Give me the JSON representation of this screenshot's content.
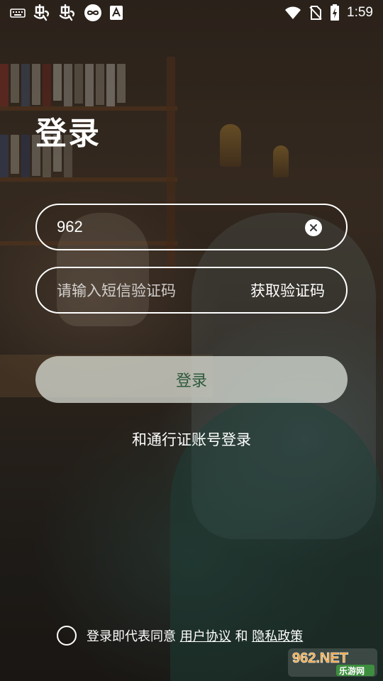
{
  "status_bar": {
    "left_icons": [
      "keyboard-icon",
      "notification-app-icon",
      "notification-app-icon",
      "infinity-app-icon",
      "text-app-icon"
    ],
    "right_icons": [
      "wifi-icon",
      "no-sim-icon",
      "battery-charging-icon"
    ],
    "time": "1:59"
  },
  "page": {
    "title": "登录"
  },
  "phone_field": {
    "value": "962"
  },
  "code_field": {
    "placeholder": "请输入短信验证码",
    "get_code_label": "获取验证码"
  },
  "login_button": {
    "label": "登录"
  },
  "alt_login": {
    "label": "和通行证账号登录"
  },
  "agreement": {
    "prefix": "登录即代表同意",
    "user_agreement": "用户协议",
    "conjunction": "和",
    "privacy_policy": "隐私政策"
  },
  "watermark": {
    "text_top": "962.NET",
    "text_bottom": "乐游网"
  },
  "colors": {
    "login_text": "#2e5a3d",
    "login_bg": "#e1e6de",
    "foreground": "#ffffff"
  }
}
